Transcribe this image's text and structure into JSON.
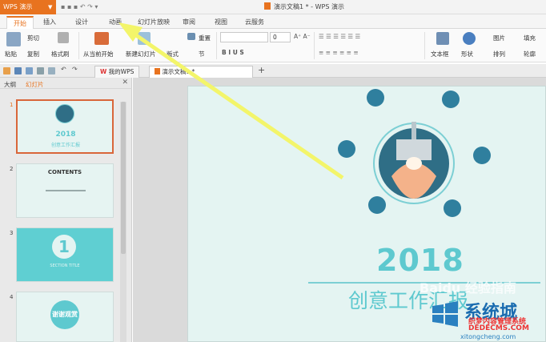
{
  "titlebar": {
    "app_label": "WPS 演示",
    "doc_title": "演示文稿1 * - WPS 演示"
  },
  "tabs": [
    "开始",
    "插入",
    "设计",
    "动画",
    "幻灯片放映",
    "审阅",
    "视图",
    "云服务"
  ],
  "ribbon": {
    "paste": "粘贴",
    "cut": "剪切",
    "copy": "复制",
    "format_painter": "格式刷",
    "from_current": "从当前开始",
    "new_slide": "新建幻灯片",
    "layout": "版式",
    "reset": "重置",
    "section": "节",
    "font_size": "0",
    "textbox": "文本框",
    "shape": "形状",
    "picture": "图片",
    "arrange": "排列",
    "fill": "填充",
    "outline": "轮廓"
  },
  "doc_tabs": {
    "my_wps": "我的WPS",
    "current": "演示文稿1 *"
  },
  "pane": {
    "outline_tab": "大纲",
    "slides_tab": "幻灯片"
  },
  "thumbs": [
    {
      "num": "1",
      "year": "2018",
      "caption": "创意工作汇报"
    },
    {
      "num": "2",
      "title": "CONTENTS"
    },
    {
      "num": "3",
      "digit": "1",
      "caption": "SECTION TITLE"
    },
    {
      "num": "4",
      "caption": "谢谢观赏"
    }
  ],
  "slide": {
    "year": "2018",
    "subtitle": "创意工作汇报"
  },
  "watermarks": {
    "baidu": "Baidu 经验指南",
    "brand": "系统城",
    "line1": "织梦内容管理系统",
    "line2": "DEDECMS.COM",
    "line3": "xitongcheng.com"
  },
  "colors": {
    "accent": "#e8731f",
    "teal": "#5ec9cf",
    "slide_bg": "#e4f4f2",
    "arrow": "#f3f56a"
  }
}
